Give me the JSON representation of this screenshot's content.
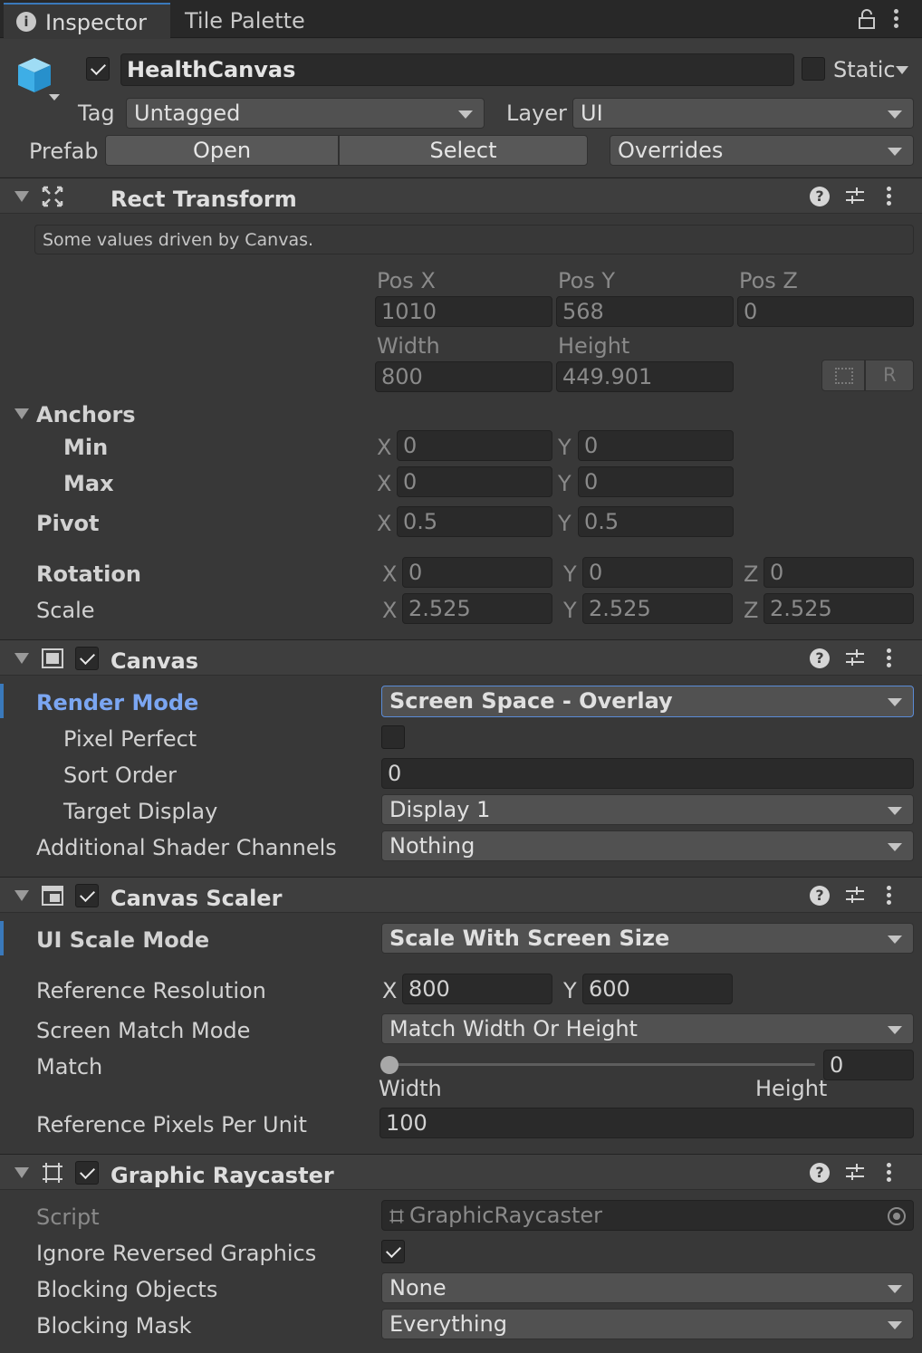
{
  "tabs": {
    "inspector": "Inspector",
    "tile_palette": "Tile Palette"
  },
  "object": {
    "name": "HealthCanvas",
    "active": true,
    "static_label": "Static",
    "static_checked": false,
    "tag_label": "Tag",
    "tag_value": "Untagged",
    "layer_label": "Layer",
    "layer_value": "UI",
    "prefab_label": "Prefab",
    "open_label": "Open",
    "select_label": "Select",
    "overrides_label": "Overrides"
  },
  "rect_transform": {
    "title": "Rect Transform",
    "info": "Some values driven by Canvas.",
    "pos_x_label": "Pos X",
    "pos_y_label": "Pos Y",
    "pos_z_label": "Pos Z",
    "pos_x": "1010",
    "pos_y": "568",
    "pos_z": "0",
    "width_label": "Width",
    "height_label": "Height",
    "width": "800",
    "height": "449.901",
    "r_label": "R",
    "anchors_label": "Anchors",
    "min_label": "Min",
    "max_label": "Max",
    "x": "X",
    "y": "Y",
    "z": "Z",
    "min_x": "0",
    "min_y": "0",
    "max_x": "0",
    "max_y": "0",
    "pivot_label": "Pivot",
    "pivot_x": "0.5",
    "pivot_y": "0.5",
    "rotation_label": "Rotation",
    "rot_x": "0",
    "rot_y": "0",
    "rot_z": "0",
    "scale_label": "Scale",
    "scale_x": "2.525",
    "scale_y": "2.525",
    "scale_z": "2.525"
  },
  "canvas": {
    "title": "Canvas",
    "enabled": true,
    "render_mode_label": "Render Mode",
    "render_mode": "Screen Space - Overlay",
    "pixel_perfect_label": "Pixel Perfect",
    "pixel_perfect": false,
    "sort_order_label": "Sort Order",
    "sort_order": "0",
    "target_display_label": "Target Display",
    "target_display": "Display 1",
    "shader_channels_label": "Additional Shader Channels",
    "shader_channels": "Nothing"
  },
  "canvas_scaler": {
    "title": "Canvas Scaler",
    "enabled": true,
    "scale_mode_label": "UI Scale Mode",
    "scale_mode": "Scale With Screen Size",
    "ref_res_label": "Reference Resolution",
    "ref_x": "800",
    "ref_y": "600",
    "match_mode_label": "Screen Match Mode",
    "match_mode": "Match Width Or Height",
    "match_label": "Match",
    "match_value": "0",
    "match_fraction": 0,
    "width_label": "Width",
    "height_label": "Height",
    "ppu_label": "Reference Pixels Per Unit",
    "ppu": "100"
  },
  "graphic_raycaster": {
    "title": "Graphic Raycaster",
    "enabled": true,
    "script_label": "Script",
    "script": "GraphicRaycaster",
    "ignore_reversed_label": "Ignore Reversed Graphics",
    "ignore_reversed": true,
    "blocking_objects_label": "Blocking Objects",
    "blocking_objects": "None",
    "blocking_mask_label": "Blocking Mask",
    "blocking_mask": "Everything"
  },
  "colors": {
    "accent": "#7ba6f2",
    "background": "#383838",
    "header": "#3e3e3e",
    "field": "#2a2a2a",
    "dropdown": "#515151"
  }
}
